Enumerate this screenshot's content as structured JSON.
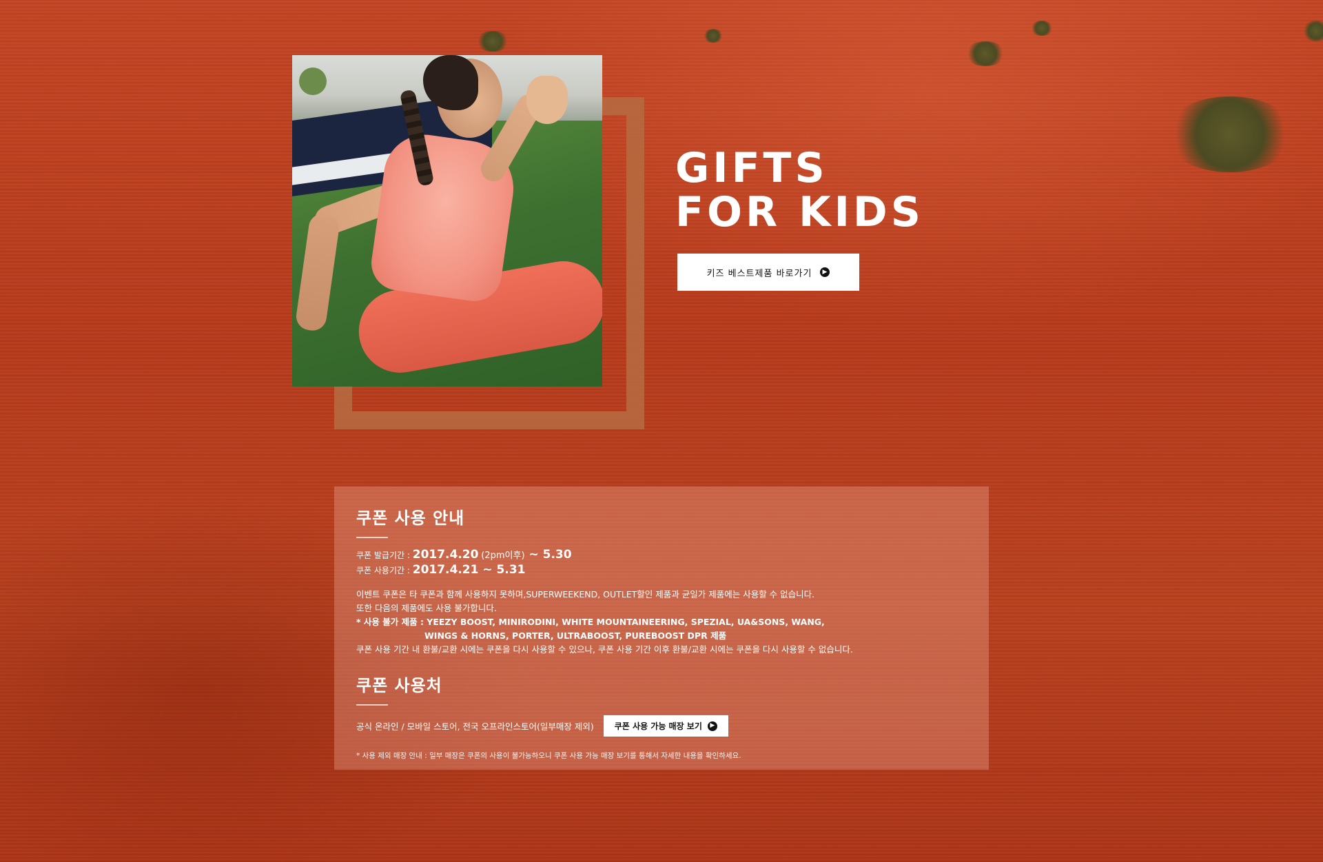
{
  "hero": {
    "title_line1": "GIFTS",
    "title_line2": "FOR KIDS",
    "cta_label": "키즈  베스트제품  바로가기",
    "cta_icon": "arrow-right-circle-icon",
    "photo_alt": "girl-running-photo"
  },
  "coupon_guide": {
    "title": "쿠폰 사용 안내",
    "issue_label": "쿠폰 발급기간 : ",
    "issue_start": "2017.4.20",
    "issue_note": "(2pm이후)",
    "issue_end": " ~ 5.30",
    "use_label": "쿠폰 사용기간 : ",
    "use_value": "2017.4.21 ~ 5.31",
    "note1": "이벤트 쿠폰은 타 쿠폰과 함께 사용하지 못하며,SUPERWEEKEND, OUTLET할인 제품과 균일가 제품에는 사용할 수 없습니다.",
    "note2": "또한 다음의 제품에도 사용 불가합니다.",
    "exclusions_line1": " * 사용 불가 제품 : YEEZY BOOST, MINIRODINI, WHITE MOUNTAINEERING, SPEZIAL, UA&SONS, WANG,",
    "exclusions_line2": "WINGS & HORNS, PORTER, ULTRABOOST, PUREBOOST DPR 제품",
    "note3": "쿠폰 사용 기간 내 환불/교환 시에는 쿠폰을 다시 사용할 수 있으나, 쿠폰 사용 기간 이후 환불/교환 시에는 쿠폰을 다시 사용할 수 없습니다."
  },
  "coupon_where": {
    "title": "쿠폰 사용처",
    "places": "공식 온라인 / 모바일 스토어, 전국 오프라인스토어(일부매장 제외)",
    "store_button_label": "쿠폰 사용 가능 매장 보기",
    "store_button_icon": "arrow-right-circle-icon",
    "footnote": "* 사용 제외 매장 안내 : 일부 매장은 쿠폰의 사용이 불가능하오니 쿠폰 사용 가능 매장 보기를 통해서 자세한 내용을 확인하세요."
  },
  "colors": {
    "background": "#c0431f",
    "frame": "#b6693f",
    "panel": "#eba996",
    "text": "#ffffff",
    "button": "#ffffff"
  }
}
